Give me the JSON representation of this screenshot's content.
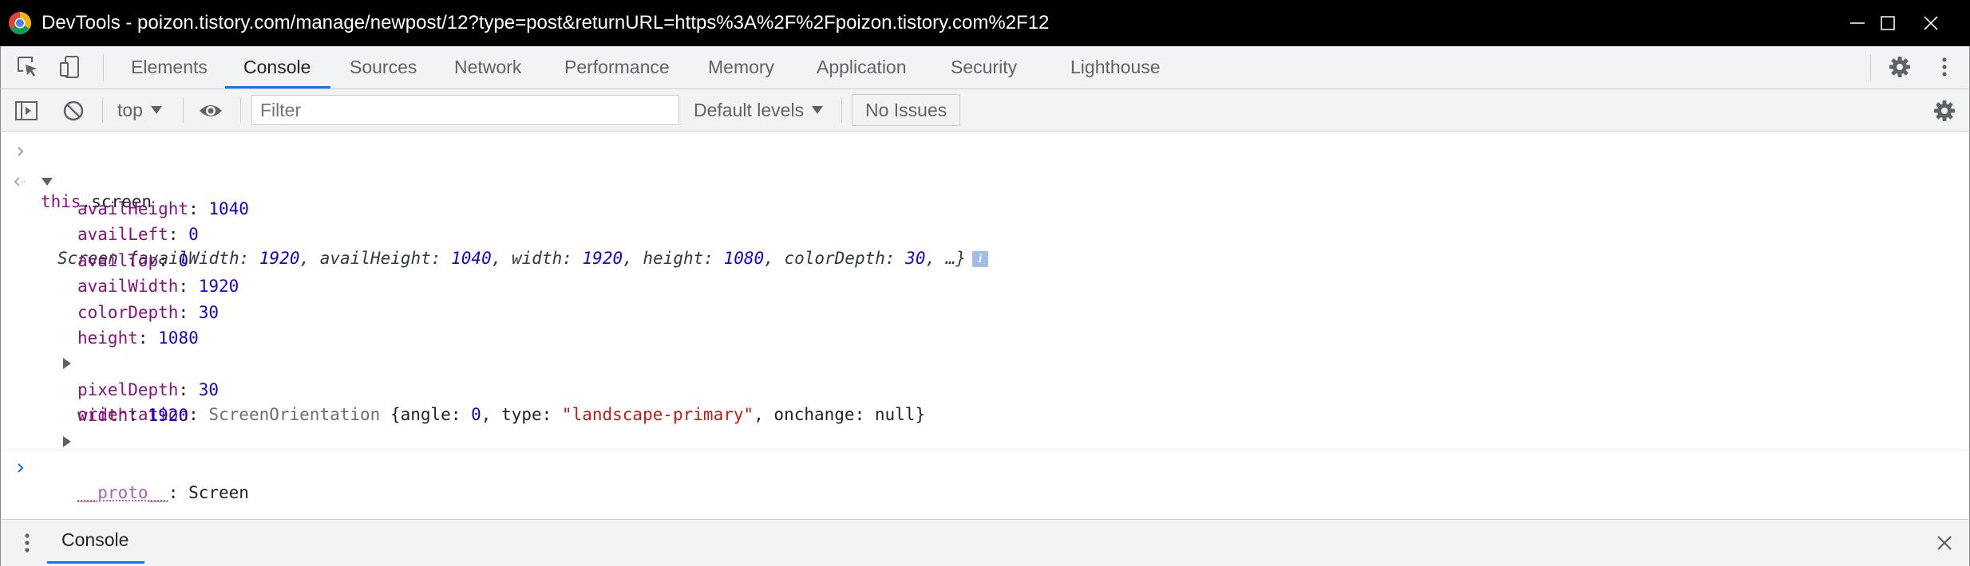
{
  "window": {
    "title": "DevTools - poizon.tistory.com/manage/newpost/12?type=post&returnURL=https%3A%2F%2Fpoizon.tistory.com%2F12"
  },
  "tabs": [
    {
      "label": "Elements"
    },
    {
      "label": "Console"
    },
    {
      "label": "Sources"
    },
    {
      "label": "Network"
    },
    {
      "label": "Performance"
    },
    {
      "label": "Memory"
    },
    {
      "label": "Application"
    },
    {
      "label": "Security"
    },
    {
      "label": "Lighthouse"
    }
  ],
  "active_tab": "Console",
  "toolbar": {
    "context": "top",
    "filter_placeholder": "Filter",
    "levels": "Default levels",
    "issues": "No Issues"
  },
  "console": {
    "input": {
      "keyword": "this",
      "rest": ".screen"
    },
    "result": {
      "class_name": "Screen",
      "preview": [
        {
          "key": "availWidth",
          "value": "1920"
        },
        {
          "key": "availHeight",
          "value": "1040"
        },
        {
          "key": "width",
          "value": "1920"
        },
        {
          "key": "height",
          "value": "1080"
        },
        {
          "key": "colorDepth",
          "value": "30"
        }
      ],
      "preview_ellipsis": "…}",
      "properties": [
        {
          "key": "availHeight",
          "value": "1040"
        },
        {
          "key": "availLeft",
          "value": "0"
        },
        {
          "key": "availTop",
          "value": "0"
        },
        {
          "key": "availWidth",
          "value": "1920"
        },
        {
          "key": "colorDepth",
          "value": "30"
        },
        {
          "key": "height",
          "value": "1080"
        }
      ],
      "orientation": {
        "key": "orientation",
        "class_name": "ScreenOrientation",
        "angle": "0",
        "type": "\"landscape-primary\"",
        "onchange": "null"
      },
      "properties_after": [
        {
          "key": "pixelDepth",
          "value": "30"
        },
        {
          "key": "width",
          "value": "1920"
        }
      ],
      "proto": {
        "key": "__proto__",
        "value": "Screen"
      }
    }
  },
  "drawer": {
    "tab": "Console"
  },
  "colors": {
    "accent": "#1a73e8",
    "prop": "#881280",
    "number": "#1c00cf",
    "string": "#c41a16"
  }
}
